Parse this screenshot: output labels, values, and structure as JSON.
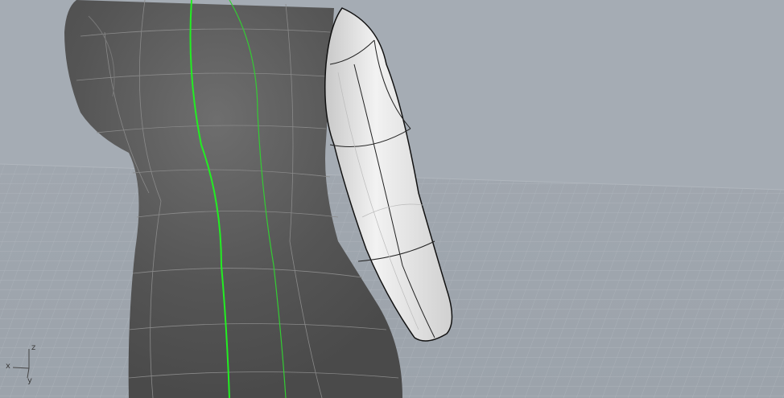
{
  "viewport": {
    "background_color": "#a5acb4",
    "grid_color": "#8f969e",
    "body_color": "#5a5a5a",
    "sleeve_color": "#e4e4e4",
    "seam_color": "#22dd22"
  },
  "axis_indicator": {
    "x_label": "x",
    "y_label": "y",
    "z_label": "z"
  }
}
